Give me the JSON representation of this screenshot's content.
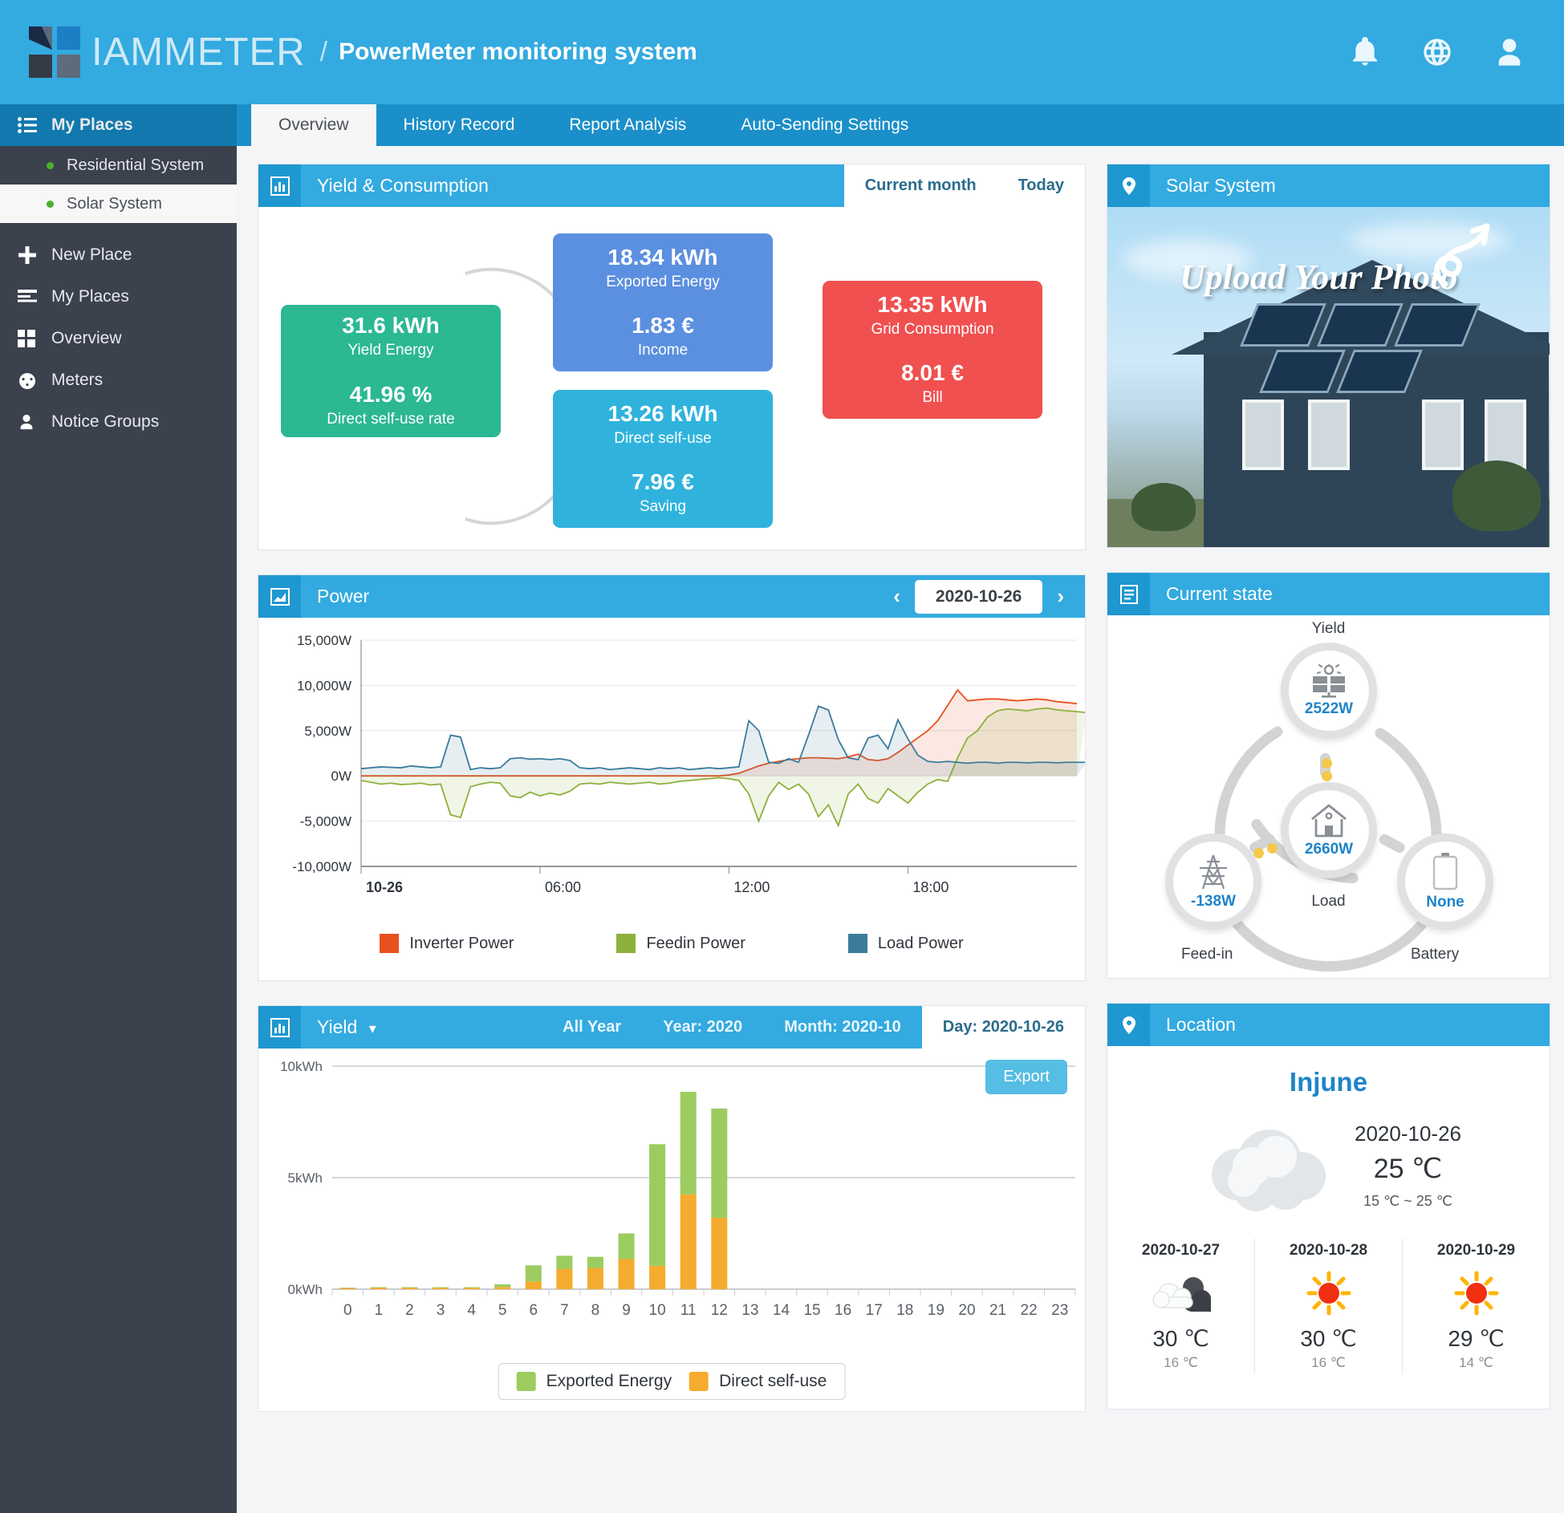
{
  "header": {
    "brand": "IAMMETER",
    "separator": "/",
    "subtitle": "PowerMeter monitoring system",
    "icons": [
      "bell-icon",
      "globe-icon",
      "user-icon"
    ]
  },
  "sidebar": {
    "header": {
      "label": "My Places",
      "icon": "list-icon"
    },
    "places": [
      {
        "label": "Residential System",
        "active": false
      },
      {
        "label": "Solar System",
        "active": true
      }
    ],
    "items": [
      {
        "label": "New Place",
        "icon": "plus-icon"
      },
      {
        "label": "My Places",
        "icon": "lines-icon"
      },
      {
        "label": "Overview",
        "icon": "grid-icon"
      },
      {
        "label": "Meters",
        "icon": "gauge-icon"
      },
      {
        "label": "Notice Groups",
        "icon": "user-icon"
      }
    ]
  },
  "tabs": [
    {
      "label": "Overview",
      "active": true
    },
    {
      "label": "History Record",
      "active": false
    },
    {
      "label": "Report Analysis",
      "active": false
    },
    {
      "label": "Auto-Sending Settings",
      "active": false
    }
  ],
  "yield_consumption": {
    "title": "Yield & Consumption",
    "icon": "bar-chart-icon",
    "range_current_month": "Current month",
    "range_today": "Today",
    "boxes": [
      {
        "id": "yield",
        "value": "31.6 kWh",
        "label": "Yield Energy",
        "value2": "41.96 %",
        "label2": "Direct self-use rate",
        "color": "#2bb893"
      },
      {
        "id": "export",
        "value": "18.34 kWh",
        "label": "Exported Energy",
        "value2": "1.83 €",
        "label2": "Income",
        "color": "#5b8fe0"
      },
      {
        "id": "selfuse",
        "value": "13.26 kWh",
        "label": "Direct self-use",
        "value2": "7.96 €",
        "label2": "Saving",
        "color": "#2fb3dd"
      },
      {
        "id": "grid",
        "value": "13.35 kWh",
        "label": "Grid Consumption",
        "value2": "8.01 €",
        "label2": "Bill",
        "color": "#f05050"
      }
    ]
  },
  "solar_system": {
    "title": "Solar System",
    "icon": "location-pin-icon",
    "photo_caption": "Upload Your Photo"
  },
  "power": {
    "title": "Power",
    "icon": "image-chart-icon",
    "date": "2020-10-26",
    "prev": "‹",
    "next": "›"
  },
  "current_state": {
    "title": "Current state",
    "icon": "document-icon",
    "nodes": [
      {
        "id": "yield",
        "label": "Yield",
        "value": "2522W",
        "icon": "solar-panel-icon"
      },
      {
        "id": "load",
        "label": "Load",
        "value": "2660W",
        "icon": "house-icon"
      },
      {
        "id": "feedin",
        "label": "Feed-in",
        "value": "-138W",
        "icon": "pylon-icon"
      },
      {
        "id": "battery",
        "label": "Battery",
        "value": "None",
        "icon": "battery-icon"
      }
    ]
  },
  "yield_panel": {
    "title": "Yield",
    "icon": "bar-chart-icon",
    "dropdown_caret": "▾",
    "ranges": [
      {
        "label": "All Year",
        "active": false
      },
      {
        "label": "Year: 2020",
        "active": false
      },
      {
        "label": "Month: 2020-10",
        "active": false
      },
      {
        "label": "Day: 2020-10-26",
        "active": true
      }
    ],
    "export_label": "Export"
  },
  "location": {
    "title": "Location",
    "icon": "location-pin-icon",
    "city": "Injune",
    "date": "2020-10-26",
    "temp": "25 ℃",
    "range": "15 ℃ ~ 25 ℃",
    "today_icon": "cloud-icon",
    "forecast": [
      {
        "date": "2020-10-27",
        "icon": "cloud-night-icon",
        "high": "30 ℃",
        "low": "16 ℃"
      },
      {
        "date": "2020-10-28",
        "icon": "sun-icon",
        "high": "30 ℃",
        "low": "16 ℃"
      },
      {
        "date": "2020-10-29",
        "icon": "sun-icon",
        "high": "29 ℃",
        "low": "14 ℃"
      }
    ]
  },
  "chart_data": [
    {
      "id": "power-chart",
      "type": "line",
      "title": "Power",
      "xlabel": "",
      "ylabel": "",
      "ylim": [
        -10000,
        15000
      ],
      "yticks": [
        "15,000W",
        "10,000W",
        "5,000W",
        "0W",
        "-5,000W",
        "-10,000W"
      ],
      "xticks": [
        "10-26",
        "06:00",
        "12:00",
        "18:00"
      ],
      "grid": true,
      "legend_position": "bottom",
      "series": [
        {
          "name": "Inverter Power",
          "color": "#e8511d",
          "values": [
            0,
            0,
            0,
            0,
            0,
            0,
            0,
            0,
            0,
            0,
            0,
            0,
            0,
            0,
            0,
            0,
            0,
            0,
            0,
            0,
            0,
            0,
            0,
            0,
            0,
            0,
            0,
            0,
            0,
            0,
            0,
            0,
            0,
            0,
            0,
            0,
            0,
            100,
            300,
            700,
            1100,
            1400,
            1600,
            1800,
            1900,
            2000,
            2000,
            1950,
            1900,
            2100,
            2400,
            1800,
            1700,
            1900,
            2600,
            3400,
            4200,
            5000,
            6100,
            7800,
            9500,
            8300,
            8400,
            8500,
            8500,
            8400,
            8300,
            8400,
            8500,
            8400,
            8200,
            8100,
            8000
          ]
        },
        {
          "name": "Feedin Power",
          "color": "#8db03c",
          "values": [
            -500,
            -700,
            -900,
            -800,
            -950,
            -900,
            -800,
            -1000,
            -900,
            -4300,
            -4600,
            -1200,
            -900,
            -700,
            -800,
            -2200,
            -2400,
            -1800,
            -2200,
            -1900,
            -2100,
            -1700,
            -900,
            -800,
            -900,
            -700,
            -800,
            -900,
            -800,
            -700,
            -900,
            -800,
            -600,
            -500,
            -400,
            -300,
            -200,
            -300,
            -500,
            -2000,
            -5000,
            -2200,
            -700,
            -1500,
            -900,
            -2000,
            -4500,
            -3200,
            -5500,
            -2000,
            -900,
            -2500,
            -3000,
            -1400,
            -2200,
            -3000,
            -1800,
            -900,
            -400,
            -600,
            2000,
            4200,
            5000,
            6500,
            7200,
            7400,
            7300,
            7200,
            7400,
            7500,
            7300,
            7200,
            7100,
            7000
          ]
        },
        {
          "name": "Load Power",
          "color": "#3b7c9b",
          "values": [
            800,
            900,
            1000,
            950,
            900,
            1100,
            1000,
            900,
            1000,
            4500,
            4300,
            700,
            900,
            800,
            900,
            1900,
            2000,
            1850,
            1900,
            1800,
            1900,
            1700,
            900,
            800,
            900,
            700,
            800,
            900,
            800,
            700,
            900,
            800,
            900,
            700,
            800,
            900,
            800,
            900,
            1000,
            6100,
            5000,
            1500,
            1400,
            1900,
            1500,
            4500,
            7700,
            7300,
            4000,
            2000,
            1800,
            4200,
            4500,
            3000,
            6200,
            4100,
            2300,
            1600,
            1500,
            1600,
            1500,
            1400,
            1500,
            1500,
            1400,
            1500,
            1500,
            1450,
            1500,
            1500,
            1450,
            1500,
            1500,
            1500
          ]
        }
      ]
    },
    {
      "id": "yield-bar-chart",
      "type": "bar",
      "stacked": true,
      "title": "Yield",
      "xlabel": "",
      "ylabel": "",
      "ylim": [
        0,
        10
      ],
      "yticks": [
        "0kWh",
        "5kWh",
        "10kWh"
      ],
      "categories": [
        "0",
        "1",
        "2",
        "3",
        "4",
        "5",
        "6",
        "7",
        "8",
        "9",
        "10",
        "11",
        "12",
        "13",
        "14",
        "15",
        "16",
        "17",
        "18",
        "19",
        "20",
        "21",
        "22",
        "23"
      ],
      "grid": true,
      "legend_position": "bottom",
      "series": [
        {
          "name": "Direct self-use",
          "color": "#f5ab2e",
          "values": [
            0.05,
            0.07,
            0.07,
            0.07,
            0.07,
            0.1,
            0.35,
            0.9,
            0.95,
            1.35,
            1.05,
            4.25,
            3.2,
            0,
            0,
            0,
            0,
            0,
            0,
            0,
            0,
            0,
            0,
            0
          ]
        },
        {
          "name": "Exported Energy",
          "color": "#9ccc5f",
          "values": [
            0.02,
            0.02,
            0.02,
            0.02,
            0.02,
            0.12,
            0.72,
            0.6,
            0.5,
            1.15,
            5.45,
            4.6,
            4.9,
            0,
            0,
            0,
            0,
            0,
            0,
            0,
            0,
            0,
            0,
            0
          ]
        }
      ]
    }
  ]
}
